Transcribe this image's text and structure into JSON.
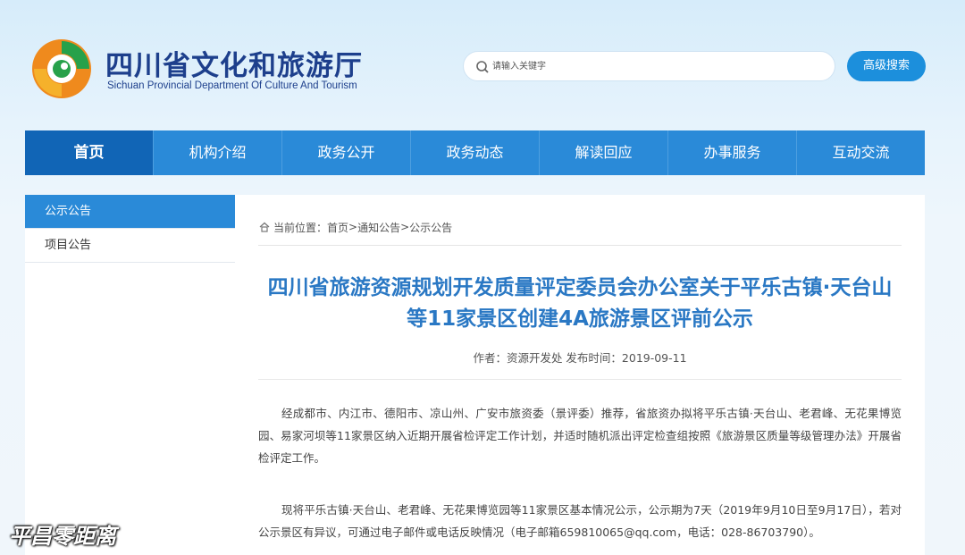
{
  "header": {
    "site_title_cn": "四川省文化和旅游厅",
    "site_title_en": "Sichuan Provincial Department Of Culture And Tourism",
    "search_placeholder": "请输入关键字",
    "advanced_search_label": "高级搜索"
  },
  "nav": {
    "items": [
      "首页",
      "机构介绍",
      "政务公开",
      "政务动态",
      "解读回应",
      "办事服务",
      "互动交流"
    ],
    "active": "首页"
  },
  "sidebar": {
    "items": [
      "公示公告",
      "项目公告"
    ],
    "active": "公示公告"
  },
  "breadcrumb": {
    "prefix": "当前位置：",
    "items": [
      "首页",
      "通知公告",
      "公示公告"
    ],
    "separator": ">"
  },
  "article": {
    "title": "四川省旅游资源规划开发质量评定委员会办公室关于平乐古镇·天台山等11家景区创建4A旅游景区评前公示",
    "meta": "作者：资源开发处   发布时间：2019-09-11",
    "paragraphs": [
      "经成都市、内江市、德阳市、凉山州、广安市旅资委（景评委）推荐，省旅资办拟将平乐古镇·天台山、老君峰、无花果博览园、易家河坝等11家景区纳入近期开展省检评定工作计划，并适时随机派出评定检查组按照《旅游景区质量等级管理办法》开展省检评定工作。",
      "现将平乐古镇·天台山、老君峰、无花果博览园等11家景区基本情况公示，公示期为7天（2019年9月10日至9月17日），若对公示景区有异议，可通过电子邮件或电话反映情况（电子邮箱659810065@qq.com，电话：028-86703790）。"
    ]
  },
  "watermark": "平昌零距离",
  "colors": {
    "nav_bg": "#2a8ad8",
    "nav_active": "#1165b6",
    "title_blue": "#1d3f8c",
    "article_title": "#2a78c4",
    "button_blue": "#1c8fdc"
  }
}
